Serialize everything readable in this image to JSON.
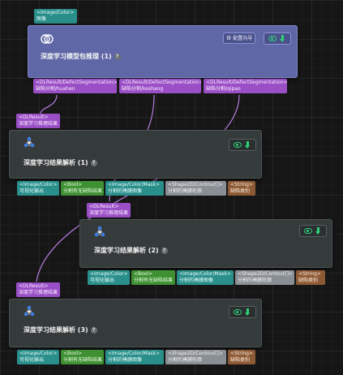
{
  "colors": {
    "teal": "#2a8e8a",
    "green": "#3f8f33",
    "grey": "#8a8f95",
    "brown": "#8d5a36",
    "purple": "#9b4fc7",
    "main_node": "#5f67a6",
    "node": "#353a3b",
    "wire": "#b67ee0"
  },
  "top_input": {
    "type": "<Image/Color>",
    "name": "图像"
  },
  "main_node": {
    "title": "深度学习模型包推理 (1)",
    "help": "?",
    "guide_button": "配置向导",
    "icon": "brain-icon",
    "outputs": [
      {
        "type": "<DLResult/DefectSegmentation>",
        "name": "缺陷分割/huahen"
      },
      {
        "type": "<DLResult/DefectSegmentation>",
        "name": "缺陷分割/keshang"
      },
      {
        "type": "<DLResult/DefectSegmentation>",
        "name": "缺陷分割/qipao"
      }
    ]
  },
  "parse_nodes": [
    {
      "title": "深度学习结果解析 (1)",
      "help": "?",
      "input": {
        "type": "<DLResult>",
        "name": "深度学习推理结果"
      },
      "outputs": [
        {
          "type": "<Image/Color>",
          "name": "可视化输出"
        },
        {
          "type": "<Bool>",
          "name": "分割有无缺陷结果"
        },
        {
          "type": "<Image/Color/Mask>",
          "name": "分割的掩膜图像"
        },
        {
          "type": "<Shape2D/Contour[]>",
          "name": "分割的掩膜轮廓"
        },
        {
          "type": "<String>",
          "name": "缺陷类别"
        }
      ]
    },
    {
      "title": "深度学习结果解析 (2)",
      "help": "?",
      "input": {
        "type": "<DLResult>",
        "name": "深度学习推理结果"
      },
      "outputs": [
        {
          "type": "<Image/Color>",
          "name": "可视化输出"
        },
        {
          "type": "<Bool>",
          "name": "分割有无缺陷结果"
        },
        {
          "type": "<Image/Color/Mask>",
          "name": "分割的掩膜图像"
        },
        {
          "type": "<Shape2D/Contour[]>",
          "name": "分割的掩膜轮廓"
        },
        {
          "type": "<String>",
          "name": "缺陷类别"
        }
      ]
    },
    {
      "title": "深度学习结果解析 (3)",
      "help": "?",
      "input": {
        "type": "<DLResult>",
        "name": "深度学习推理结果"
      },
      "outputs": [
        {
          "type": "<Image/Color>",
          "name": "可视化输出"
        },
        {
          "type": "<Bool>",
          "name": "分割有无缺陷结果"
        },
        {
          "type": "<Image/Color/Mask>",
          "name": "分割的掩膜图像"
        },
        {
          "type": "<Shape2D/Contour[]>",
          "name": "分割的掩膜轮廓"
        },
        {
          "type": "<String>",
          "name": "缺陷类别"
        }
      ]
    }
  ]
}
